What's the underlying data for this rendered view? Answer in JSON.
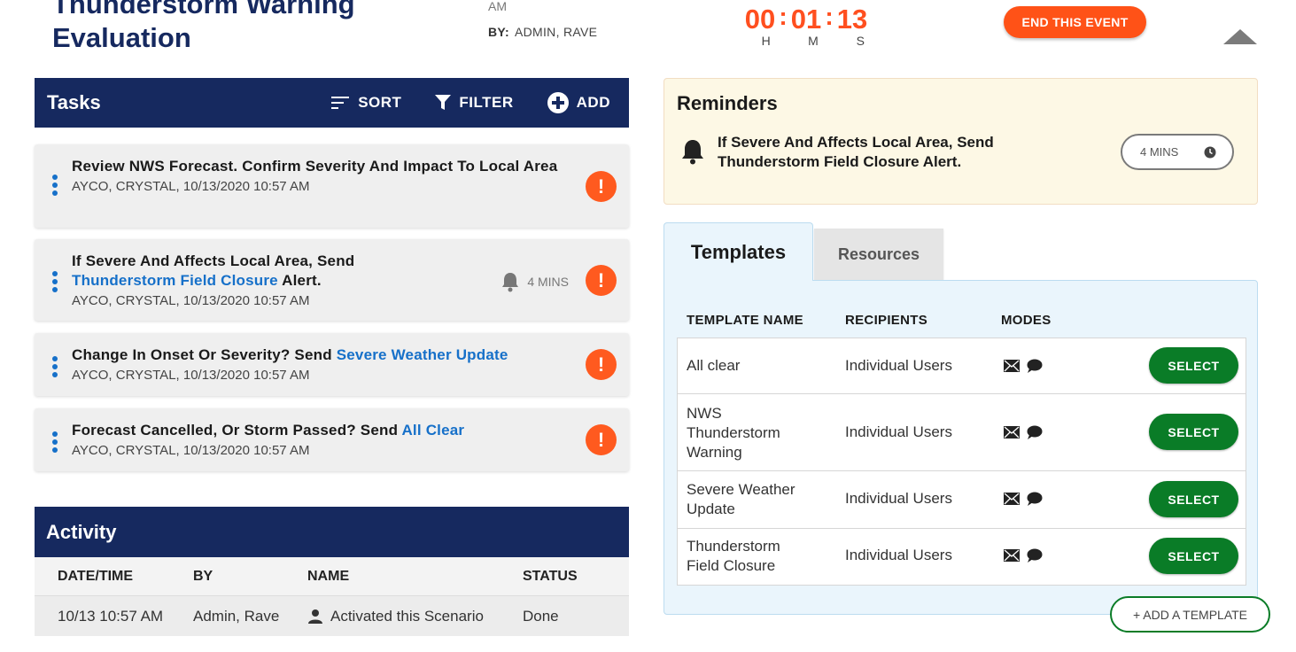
{
  "header": {
    "title": "Thunderstorm Warning Evaluation",
    "created_cut": "AM",
    "by_label": "BY:",
    "by_value": "ADMIN, RAVE",
    "timer": {
      "h": "00",
      "m": "01",
      "s": "13",
      "h_label": "H",
      "m_label": "M",
      "s_label": "S",
      "color": "#ff4f1f"
    },
    "end_button": "END THIS EVENT",
    "accent": "#16295f"
  },
  "tasks": {
    "title": "Tasks",
    "sort": "SORT",
    "filter": "FILTER",
    "add": "ADD",
    "items": [
      {
        "text": "Review NWS Forecast. Confirm Severity And Impact To Local Area",
        "meta": "AYCO, CRYSTAL, 10/13/2020 10:57 AM"
      },
      {
        "text_before": "If Severe And Affects Local Area, Send",
        "link": "Thunderstorm Field Closure",
        "text_after": " Alert.",
        "meta": "AYCO, CRYSTAL, 10/13/2020 10:57 AM",
        "reminder": "4 MINS"
      },
      {
        "text_before": "Change In Onset Or Severity? Send ",
        "link": "Severe Weather Update",
        "meta": "AYCO, CRYSTAL, 10/13/2020 10:57 AM"
      },
      {
        "text_before": "Forecast Cancelled, Or Storm Passed? Send ",
        "link": "All Clear",
        "meta": "AYCO, CRYSTAL, 10/13/2020 10:57 AM"
      }
    ]
  },
  "activity": {
    "title": "Activity",
    "columns": [
      "DATE/TIME",
      "BY",
      "NAME",
      "STATUS"
    ],
    "rows": [
      {
        "datetime": "10/13 10:57 AM",
        "by": "Admin, Rave",
        "name": "Activated this Scenario",
        "status": "Done"
      }
    ]
  },
  "reminders": {
    "title": "Reminders",
    "text": "If Severe And Affects Local Area, Send Thunderstorm Field Closure Alert.",
    "time": "4 MINS"
  },
  "templates": {
    "tab_active": "Templates",
    "tab_inactive": "Resources",
    "columns": [
      "TEMPLATE NAME",
      "RECIPIENTS",
      "MODES"
    ],
    "rows": [
      {
        "name": "All clear",
        "recipients": "Individual Users",
        "modes": [
          "email-icon",
          "chat-icon"
        ],
        "action": "SELECT"
      },
      {
        "name": "NWS Thunderstorm Warning",
        "recipients": "Individual Users",
        "modes": [
          "email-icon",
          "chat-icon"
        ],
        "action": "SELECT"
      },
      {
        "name": "Severe Weather Update",
        "recipients": "Individual Users",
        "modes": [
          "email-icon",
          "chat-icon"
        ],
        "action": "SELECT"
      },
      {
        "name": "Thunderstorm Field Closure",
        "recipients": "Individual Users",
        "modes": [
          "email-icon",
          "chat-icon"
        ],
        "action": "SELECT"
      }
    ],
    "add_button": "+ ADD A TEMPLATE",
    "select_color": "#0a7c27"
  }
}
